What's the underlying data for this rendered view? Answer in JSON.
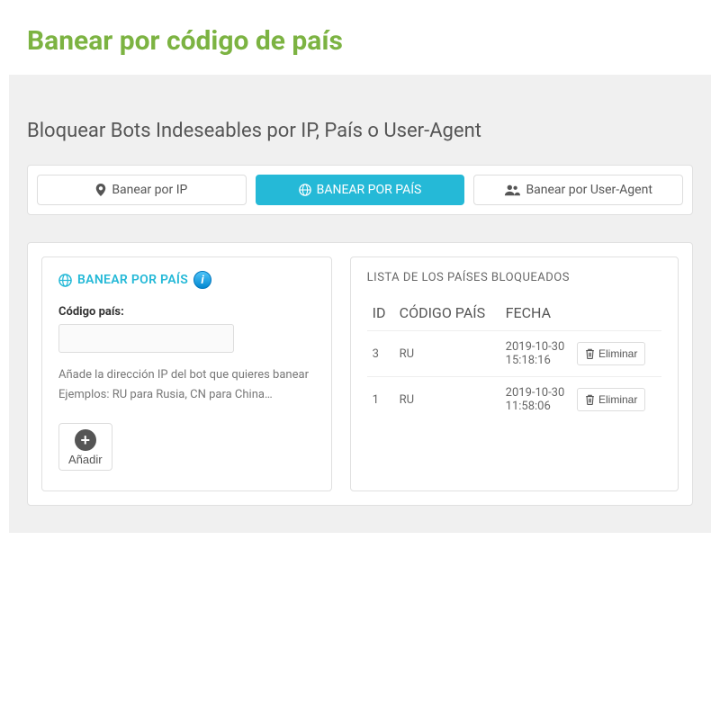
{
  "page": {
    "title": "Banear por código de país",
    "section_heading": "Bloquear Bots Indeseables por IP, País o User-Agent"
  },
  "tabs": [
    {
      "label": "Banear por IP",
      "icon": "map-marker",
      "active": false
    },
    {
      "label": "BANEAR POR PAÍS",
      "icon": "globe",
      "active": true
    },
    {
      "label": "Banear por User-Agent",
      "icon": "users",
      "active": false
    }
  ],
  "form": {
    "panel_title": "BANEAR POR PAÍS",
    "label": "Código país:",
    "value": "",
    "help_line_1": "Añade la dirección IP del bot que quieres banear",
    "help_line_2": "Ejemplos: RU para Rusia, CN para China…",
    "add_label": "Añadir"
  },
  "blocked_list": {
    "title": "LISTA DE LOS PAÍSES BLOQUEADOS",
    "columns": {
      "id": "ID",
      "code": "CÓDIGO PAÍS",
      "date": "FECHA"
    },
    "rows": [
      {
        "id": "3",
        "code": "RU",
        "date": "2019-10-30 15:18:16",
        "delete_label": "Eliminar"
      },
      {
        "id": "1",
        "code": "RU",
        "date": "2019-10-30 11:58:06",
        "delete_label": "Eliminar"
      }
    ]
  },
  "colors": {
    "accent_green": "#7cb342",
    "accent_blue": "#25b9d7"
  }
}
